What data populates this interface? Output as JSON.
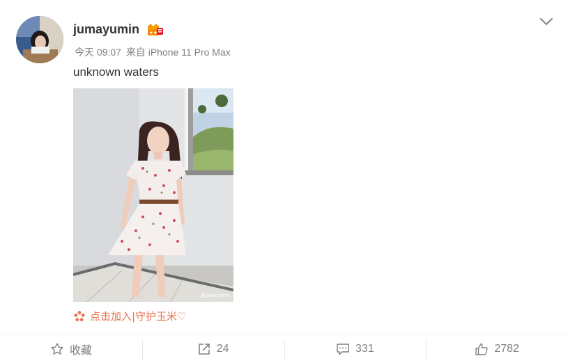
{
  "post": {
    "username": "jumayumin",
    "timestamp": "今天 09:07",
    "source": "来自 iPhone 11 Pro Max",
    "text": "unknown waters",
    "photo_watermark": "@jumayumin",
    "promo": "点击加入|守护玉米♡"
  },
  "icons": {
    "avatar": "avatar",
    "vip_badge": "vip-badge-icon",
    "menu": "chevron-down-icon",
    "promo": "flower-icon",
    "favorite": "star-icon",
    "repost": "share-icon",
    "comment": "comment-icon",
    "like": "thumbs-up-icon"
  },
  "actions": {
    "favorite_label": "收藏",
    "repost_count": "24",
    "comment_count": "331",
    "like_count": "2782"
  },
  "colors": {
    "promo": "#eb7350",
    "meta": "#808080",
    "text": "#333333"
  }
}
